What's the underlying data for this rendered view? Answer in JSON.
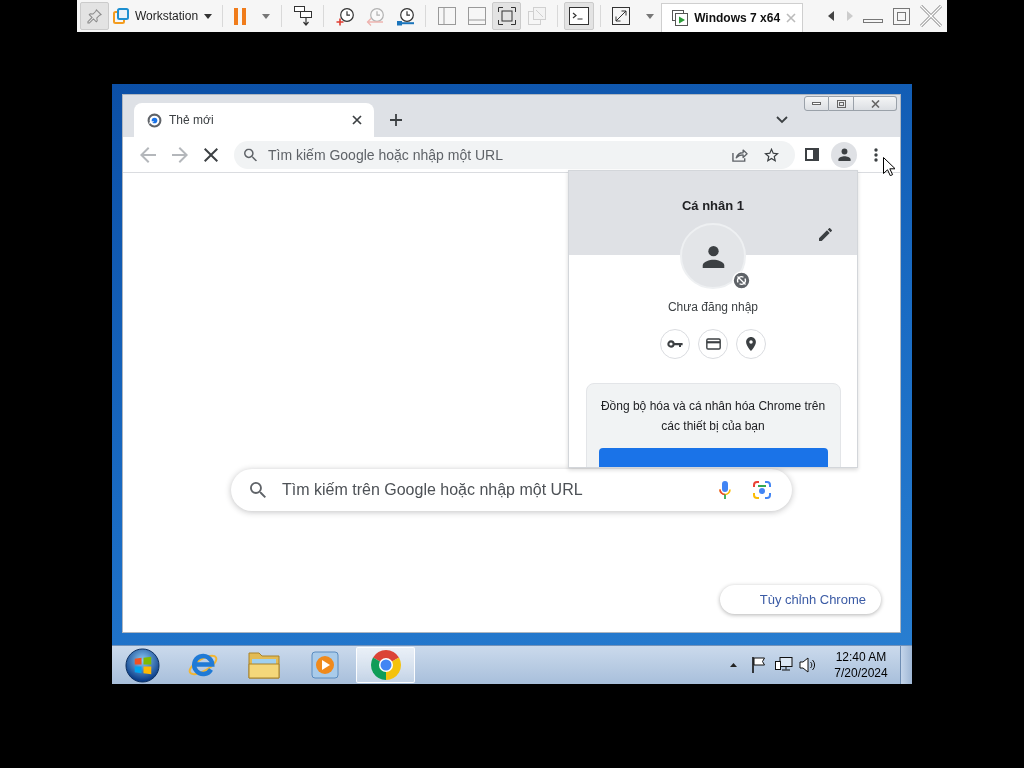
{
  "vmware": {
    "pin": {
      "pressed": true
    },
    "menu": {
      "label": "Workstation"
    },
    "tool_groups": [
      [
        {
          "kind": "pause",
          "pressed": false,
          "disabled": false,
          "dropdown": true
        }
      ],
      [
        {
          "kind": "send-keys",
          "pressed": false,
          "disabled": false,
          "dropdown": false
        }
      ],
      [
        {
          "kind": "snapshot-take",
          "pressed": false,
          "disabled": false,
          "dropdown": false
        },
        {
          "kind": "snapshot-revert",
          "pressed": false,
          "disabled": true,
          "dropdown": false
        },
        {
          "kind": "snapshot-manager",
          "pressed": false,
          "disabled": false,
          "dropdown": false
        }
      ],
      [
        {
          "kind": "view-library",
          "pressed": false,
          "disabled": false,
          "dropdown": false
        },
        {
          "kind": "view-thumbnails",
          "pressed": false,
          "disabled": false,
          "dropdown": false
        },
        {
          "kind": "view-fit",
          "pressed": true,
          "disabled": false,
          "dropdown": false
        },
        {
          "kind": "view-unity",
          "pressed": false,
          "disabled": true,
          "dropdown": false
        }
      ],
      [
        {
          "kind": "console",
          "pressed": true,
          "disabled": false,
          "dropdown": false
        }
      ],
      [
        {
          "kind": "full-screen",
          "pressed": false,
          "disabled": false,
          "dropdown": true
        }
      ]
    ],
    "tabs": [
      {
        "title": "Windows 7 x64",
        "selected": true
      }
    ],
    "scroll_left": {
      "disabled": false
    },
    "scroll_right": {
      "disabled": true
    }
  },
  "browser": {
    "tabs": [
      {
        "title": "Thẻ mới",
        "selected": true
      }
    ],
    "back": {
      "disabled": true
    },
    "forward": {
      "disabled": true
    },
    "loading": true,
    "address_bar": {
      "placeholder": "Tìm kiếm Google hoặc nhập một URL"
    },
    "profile_menu": {
      "title": "Cá nhân 1",
      "status": "Chưa đăng nhập",
      "sync_message": "Đồng bộ hóa và cá nhân hóa Chrome trên các thiết bị của bạn"
    },
    "new_tab_page": {
      "search_box": {
        "placeholder": "Tìm kiếm trên Google hoặc nhập một URL"
      },
      "customize_button": {
        "label": "Tùy chỉnh Chrome"
      }
    }
  },
  "taskbar": {
    "apps": [
      {
        "kind": "e-globe",
        "selected": false
      },
      {
        "kind": "folder",
        "selected": false
      },
      {
        "kind": "player",
        "selected": false
      },
      {
        "kind": "ring-ball",
        "selected": true
      }
    ],
    "clock": {
      "time": "12:40 AM",
      "date": "7/20/2024"
    }
  }
}
